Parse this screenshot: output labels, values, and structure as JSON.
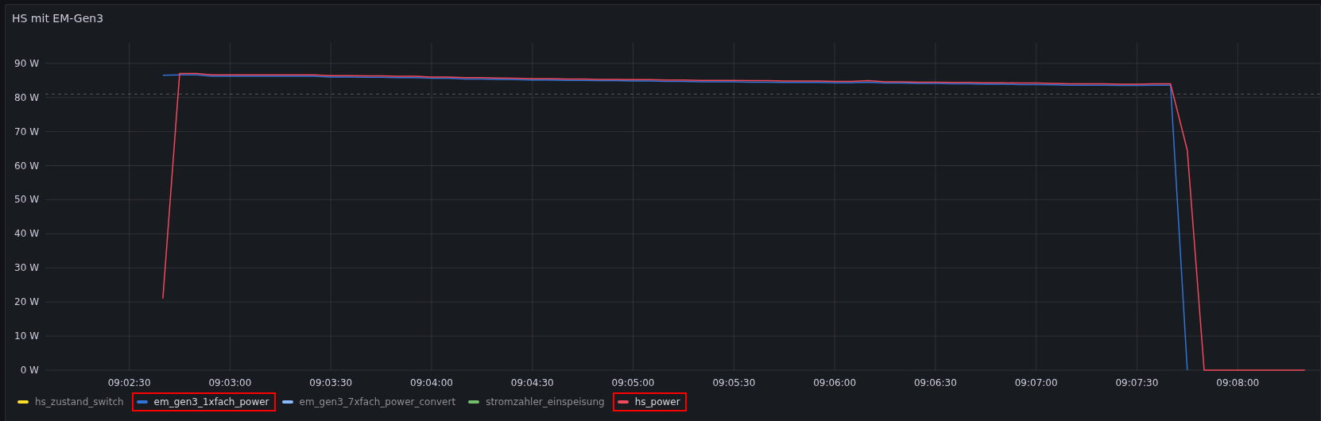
{
  "panel": {
    "title": "HS mit EM-Gen3",
    "chart_data": {
      "type": "line",
      "grid": true,
      "ylim": [
        0,
        96
      ],
      "yticks": [
        {
          "value": 0,
          "label": "0 W"
        },
        {
          "value": 10,
          "label": "10 W"
        },
        {
          "value": 20,
          "label": "20 W"
        },
        {
          "value": 30,
          "label": "30 W"
        },
        {
          "value": 40,
          "label": "40 W"
        },
        {
          "value": 50,
          "label": "50 W"
        },
        {
          "value": 60,
          "label": "60 W"
        },
        {
          "value": 70,
          "label": "70 W"
        },
        {
          "value": 80,
          "label": "80 W"
        },
        {
          "value": 90,
          "label": "90 W"
        }
      ],
      "categories": [
        null,
        null,
        null,
        null,
        null,
        "09:02:30",
        null,
        null,
        null,
        null,
        null,
        "09:03:00",
        null,
        null,
        null,
        null,
        null,
        "09:03:30",
        null,
        null,
        null,
        null,
        null,
        "09:04:00",
        null,
        null,
        null,
        null,
        null,
        "09:04:30",
        null,
        null,
        null,
        null,
        null,
        "09:05:00",
        null,
        null,
        null,
        null,
        null,
        "09:05:30",
        null,
        null,
        null,
        null,
        null,
        "09:06:00",
        null,
        null,
        null,
        null,
        null,
        "09:06:30",
        null,
        null,
        null,
        null,
        null,
        "09:07:00",
        null,
        null,
        null,
        null,
        null,
        "09:07:30",
        null,
        null,
        null,
        null,
        null,
        "09:08:00",
        null,
        null,
        null,
        null
      ],
      "series": [
        {
          "name": "hs_zustand_switch",
          "color": "#fade2a",
          "values": [
            null,
            null,
            null,
            null,
            null,
            null,
            null,
            null,
            null,
            null,
            null,
            null,
            null,
            null,
            null,
            null,
            null,
            null,
            null,
            null,
            null,
            null,
            null,
            null,
            null,
            null,
            null,
            null,
            null,
            null,
            null,
            null,
            null,
            null,
            null,
            null,
            null,
            null,
            null,
            null,
            null,
            null,
            null,
            null,
            null,
            null,
            null,
            null,
            null,
            null,
            null,
            null,
            null,
            null,
            null,
            null,
            null,
            null,
            null,
            null,
            null,
            null,
            null,
            null,
            null,
            null,
            null,
            null,
            null,
            null,
            null,
            null,
            null,
            null,
            null,
            null
          ]
        },
        {
          "name": "em_gen3_1xfach_power",
          "color": "#3274d9",
          "values": [
            null,
            null,
            null,
            null,
            null,
            null,
            null,
            86.5,
            86.6,
            86.6,
            86.2,
            86.2,
            86.2,
            86.2,
            86.2,
            86.2,
            86.2,
            86.0,
            86.0,
            85.9,
            85.9,
            85.8,
            85.8,
            85.6,
            85.6,
            85.4,
            85.4,
            85.3,
            85.2,
            85.1,
            85.1,
            85.0,
            85.0,
            84.9,
            84.9,
            84.8,
            84.8,
            84.7,
            84.7,
            84.6,
            84.6,
            84.6,
            84.5,
            84.5,
            84.4,
            84.4,
            84.4,
            84.3,
            84.3,
            84.5,
            84.2,
            84.2,
            84.1,
            84.1,
            84.0,
            84.0,
            83.9,
            83.9,
            83.8,
            83.8,
            83.7,
            83.6,
            83.6,
            83.6,
            83.5,
            83.5,
            83.6,
            83.6,
            0,
            null,
            null,
            null,
            null,
            null,
            null,
            null
          ]
        },
        {
          "name": "em_gen3_7xfach_power_convert",
          "color": "#8ab8ff",
          "values": [
            null,
            null,
            null,
            null,
            null,
            null,
            null,
            null,
            null,
            null,
            null,
            null,
            null,
            null,
            null,
            null,
            null,
            null,
            null,
            null,
            null,
            null,
            null,
            null,
            null,
            null,
            null,
            null,
            null,
            null,
            null,
            null,
            null,
            null,
            null,
            null,
            null,
            null,
            null,
            null,
            null,
            null,
            null,
            null,
            null,
            null,
            null,
            null,
            null,
            null,
            null,
            null,
            null,
            null,
            null,
            null,
            null,
            null,
            null,
            null,
            null,
            null,
            null,
            null,
            null,
            null,
            null,
            null,
            null,
            null,
            null,
            null,
            null,
            null,
            null,
            null
          ]
        },
        {
          "name": "stromzahler_einspeisung",
          "color": "#73bf69",
          "values": [
            null,
            null,
            null,
            null,
            null,
            null,
            null,
            null,
            null,
            null,
            null,
            null,
            null,
            null,
            null,
            null,
            null,
            null,
            null,
            null,
            null,
            null,
            null,
            null,
            null,
            null,
            null,
            null,
            null,
            null,
            null,
            null,
            null,
            null,
            null,
            null,
            null,
            null,
            null,
            null,
            null,
            null,
            null,
            null,
            null,
            null,
            null,
            null,
            null,
            null,
            null,
            null,
            null,
            null,
            null,
            null,
            null,
            null,
            null,
            null,
            null,
            null,
            null,
            null,
            null,
            null,
            null,
            null,
            null,
            null,
            null,
            null,
            null,
            null,
            null,
            null
          ]
        },
        {
          "name": "hs_power",
          "color": "#f2495c",
          "values": [
            null,
            null,
            null,
            null,
            null,
            null,
            null,
            21,
            87,
            87,
            86.6,
            86.6,
            86.6,
            86.6,
            86.6,
            86.6,
            86.6,
            86.4,
            86.4,
            86.3,
            86.3,
            86.2,
            86.2,
            86.0,
            86.0,
            85.8,
            85.8,
            85.7,
            85.6,
            85.5,
            85.5,
            85.4,
            85.4,
            85.3,
            85.3,
            85.2,
            85.2,
            85.1,
            85.1,
            85.0,
            85.0,
            85.0,
            84.9,
            84.9,
            84.8,
            84.8,
            84.8,
            84.7,
            84.7,
            84.9,
            84.6,
            84.6,
            84.5,
            84.5,
            84.4,
            84.4,
            84.3,
            84.3,
            84.2,
            84.2,
            84.1,
            84.0,
            84.0,
            84.0,
            83.9,
            83.9,
            84.0,
            84.0,
            64.5,
            0,
            0,
            0,
            0,
            0,
            0,
            0
          ]
        }
      ],
      "stacked": false,
      "ref_lines": [
        {
          "axis": "y",
          "value": 81
        }
      ]
    },
    "legend": [
      {
        "highlighted": false
      },
      {
        "highlighted": true
      },
      {
        "highlighted": false
      },
      {
        "highlighted": false
      },
      {
        "highlighted": true
      }
    ]
  }
}
